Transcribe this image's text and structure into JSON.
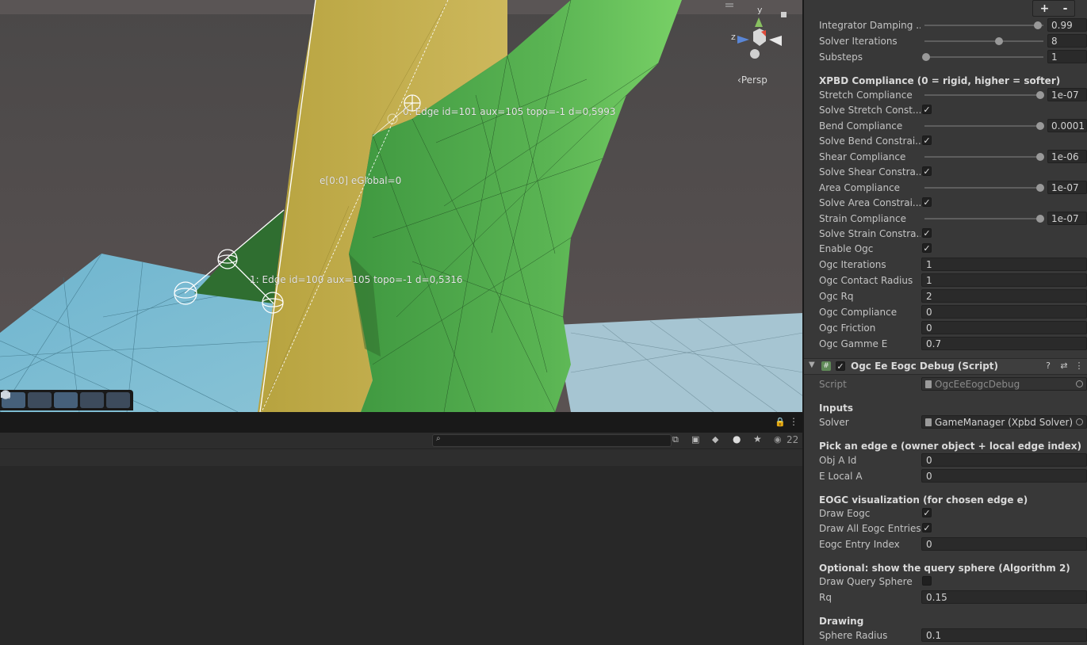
{
  "scene": {
    "label_edge0": "0: Edge id=101 aux=105 topo=-1  d=0,5993",
    "label_edge1": "1: Edge id=100 aux=105 topo=-1  d=0,5316",
    "label_center": "e[0:0]  eGlobal=0",
    "persp": "Persp",
    "gizmo_y": "y",
    "gizmo_z": "z"
  },
  "console": {
    "count": "22"
  },
  "toolbar": {
    "plus": "+",
    "minus": "-"
  },
  "inspector": {
    "solver_rows": [
      {
        "label": "Integrator Damping ...",
        "value": "0.99",
        "slider": 0.99
      },
      {
        "label": "Solver Iterations",
        "value": "8",
        "slider": 0.61
      },
      {
        "label": "Substeps",
        "value": "1",
        "slider": 0.0
      }
    ],
    "xpbd_header": "XPBD Compliance (0 = rigid, higher = softer)",
    "compliance": [
      {
        "label": "Stretch Compliance",
        "value": "1e-07",
        "toggle_label": "Solve Stretch Const...",
        "checked": true
      },
      {
        "label": "Bend Compliance",
        "value": "0.0001",
        "toggle_label": "Solve Bend Constrai...",
        "checked": true
      },
      {
        "label": "Shear Compliance",
        "value": "1e-06",
        "toggle_label": "Solve Shear Constra...",
        "checked": true
      },
      {
        "label": "Area Compliance",
        "value": "1e-07",
        "toggle_label": "Solve Area Constrai...",
        "checked": true
      },
      {
        "label": "Strain Compliance",
        "value": "1e-07",
        "toggle_label": "Solve Strain Constra...",
        "checked": true
      }
    ],
    "enable_ogc": {
      "label": "Enable Ogc",
      "checked": true
    },
    "ogc_fields": [
      {
        "label": "Ogc Iterations",
        "value": "1"
      },
      {
        "label": "Ogc Contact Radius",
        "value": "1"
      },
      {
        "label": "Ogc Rq",
        "value": "2"
      },
      {
        "label": "Ogc Compliance",
        "value": "0"
      },
      {
        "label": "Ogc Friction",
        "value": "0"
      },
      {
        "label": "Ogc Gamme E",
        "value": "0.7"
      }
    ],
    "component_title": "Ogc Ee Eogc Debug (Script)",
    "script_label": "Script",
    "script_value": "OgcEeEogcDebug",
    "inputs_header": "Inputs",
    "solver_label": "Solver",
    "solver_value": "GameManager (Xpbd Solver)",
    "pick_header": "Pick an edge e (owner object + local edge index)",
    "obj_a_id": {
      "label": "Obj A Id",
      "value": "0"
    },
    "e_local_a": {
      "label": "E Local A",
      "value": "0"
    },
    "eogc_header": "EOGC visualization (for chosen edge e)",
    "draw_eogc": {
      "label": "Draw Eogc",
      "checked": true
    },
    "draw_all": {
      "label": "Draw All Eogc Entries",
      "checked": true
    },
    "entry_index": {
      "label": "Eogc Entry Index",
      "value": "0"
    },
    "optional_header": "Optional: show the query sphere (Algorithm 2)",
    "draw_query": {
      "label": "Draw Query Sphere",
      "checked": false
    },
    "rq": {
      "label": "Rq",
      "value": "0.15"
    },
    "drawing_header": "Drawing",
    "sphere_radius": {
      "label": "Sphere Radius",
      "value": "0.1"
    }
  },
  "colors": {
    "floor": "#7fb4c8",
    "green_mesh": "#5cb455",
    "yellow_mesh": "#c2ad47",
    "dark_green": "#2e6e2e",
    "sky": "#4a4646"
  }
}
